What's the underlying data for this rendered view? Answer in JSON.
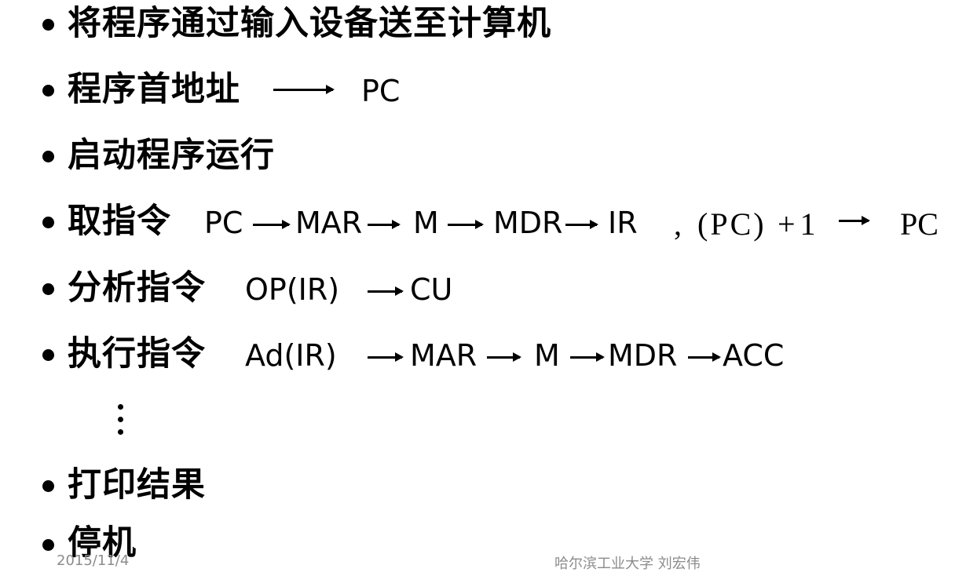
{
  "slide": {
    "items": [
      {
        "label": "将程序通过输入设备送至计算机"
      },
      {
        "label": "程序首地址",
        "seq": [
          "PC"
        ]
      },
      {
        "label": "启动程序运行"
      },
      {
        "label": "取指令",
        "seq": [
          "PC",
          "MAR",
          "M",
          "MDR",
          "IR"
        ],
        "extra": [
          ",",
          "(PC)",
          "+1",
          "PC"
        ]
      },
      {
        "label": "分析指令",
        "seq": [
          "OP(IR)",
          "CU"
        ]
      },
      {
        "label": "执行指令",
        "seq": [
          "Ad(IR)",
          "MAR",
          "M",
          "MDR",
          "ACC"
        ]
      },
      {
        "label": "打印结果"
      },
      {
        "label": "停机"
      }
    ],
    "ellipsis": "⋮"
  },
  "footer": {
    "date": "2015/11/4",
    "author": "哈尔滨工业大学  刘宏伟"
  }
}
